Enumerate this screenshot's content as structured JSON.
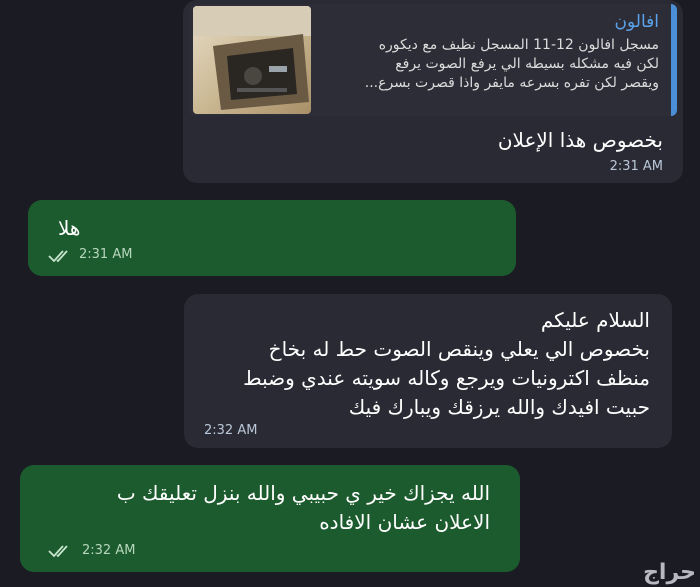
{
  "messages": {
    "ad_reply": {
      "ad_title": "افالون",
      "ad_line1": "مسجل افالون 12-11 المسجل نظيف مع ديكوره",
      "ad_line2": "لكن فيه مشكله بسيطه الي يرفع الصوت يرفع",
      "ad_line3": "ويقصر لكن تفره بسرعه مايفر واذا قصرت بسرع...",
      "text": "بخصوص هذا الإعلان",
      "time": "2:31 AM"
    },
    "hala": {
      "text": "هلا",
      "time": "2:31 AM",
      "status_icon": "double-check-icon"
    },
    "incoming_long": {
      "line1": "السلام عليكم",
      "line2": "بخصوص الي يعلي وينقص  الصوت حط له بخاخ",
      "line3": "منظف اكترونيات ويرجع وكاله سويته عندي وضبط",
      "line4": "حبيت افيدك والله يرزقك ويبارك فيك",
      "time": "2:32 AM"
    },
    "outgoing_thanks": {
      "line1": "الله يجزاك خير ي حبيبي والله بنزل تعليقك ب",
      "line2": "الاعلان عشان الافاده",
      "time": "2:32 AM",
      "status_icon": "double-check-icon"
    }
  },
  "watermark": "حراج",
  "colors": {
    "background": "#1b1b23",
    "incoming_bubble": "#2a2a34",
    "outgoing_bubble": "#1c5b2d",
    "link_accent": "#5aa3ea"
  }
}
